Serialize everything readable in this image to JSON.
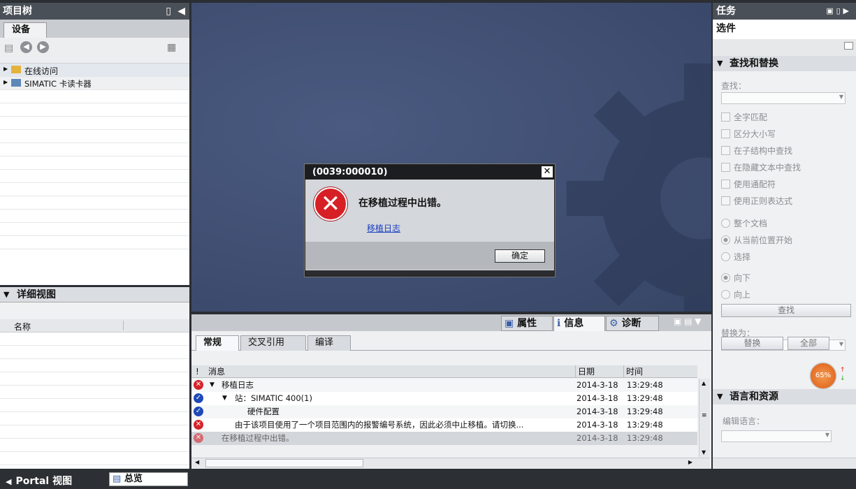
{
  "project_tree": {
    "title": "项目树",
    "tab": "设备",
    "items": [
      "在线访问",
      "SIMATIC 卡读卡器"
    ]
  },
  "detail_view": {
    "title": "详细视图",
    "col_name": "名称"
  },
  "tasks": {
    "title": "任务",
    "options_label": "选件",
    "find_replace": "查找和替换",
    "find_label": "查找：",
    "checks": [
      "全字匹配",
      "区分大小写",
      "在子结构中查找",
      "在隐藏文本中查找",
      "使用通配符",
      "使用正则表达式"
    ],
    "radios_scope": [
      "整个文档",
      "从当前位置开始",
      "选择"
    ],
    "radios_dir": [
      "向下",
      "向上"
    ],
    "find_button": "查找",
    "replace_label": "替换为：",
    "replace_button": "替换",
    "replace_all_button": "全部",
    "lang_res": "语言和资源",
    "edit_lang": "编辑语言："
  },
  "dialog": {
    "title": "(0039:000010)",
    "message": "在移植过程中出错。",
    "link": "移植日志",
    "ok": "确定"
  },
  "inspector": {
    "tabs_top": [
      "属性",
      "信息",
      "诊断"
    ],
    "tabs": [
      "常规",
      "交叉引用",
      "编译"
    ],
    "col_msg": "消息",
    "col_date": "日期",
    "col_time": "时间",
    "bang": "!",
    "rows": [
      {
        "msg": "移植日志",
        "date": "2014-3-18",
        "time": "13:29:48",
        "icon": "error"
      },
      {
        "msg": "站：SIMATIC 400(1)",
        "date": "2014-3-18",
        "time": "13:29:48",
        "icon": "ok"
      },
      {
        "msg": "硬件配置",
        "date": "2014-3-18",
        "time": "13:29:48",
        "icon": "ok"
      },
      {
        "msg": "由于该项目使用了一个项目范围内的报警编号系统，因此必须中止移植。请切换...",
        "date": "2014-3-18",
        "time": "13:29:48",
        "icon": "error"
      },
      {
        "msg": "在移植过程中出错。",
        "date": "2014-3-18",
        "time": "13:29:48",
        "icon": "error"
      }
    ]
  },
  "statusbar": {
    "portal": "Portal 视图",
    "overview": "总览",
    "percent": "65%"
  }
}
